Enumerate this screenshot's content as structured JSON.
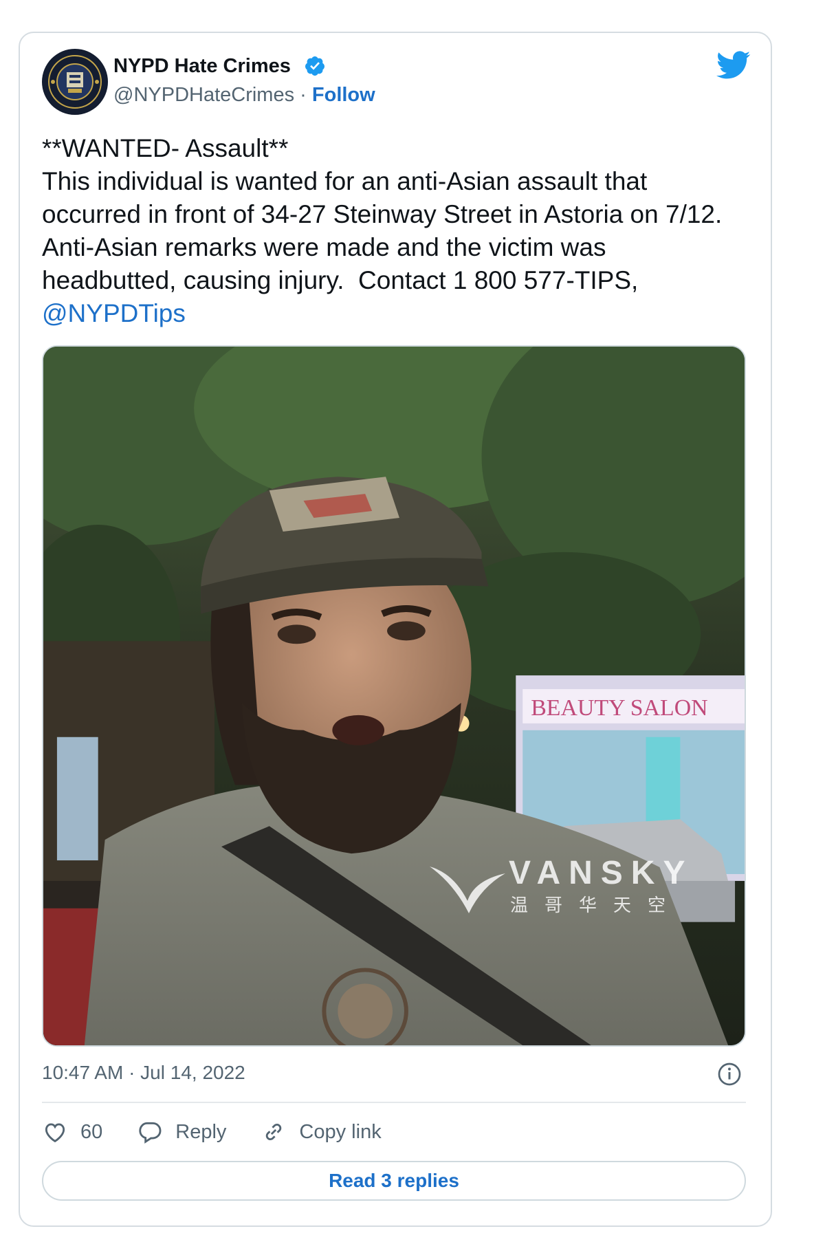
{
  "author": {
    "display_name": "NYPD Hate Crimes",
    "handle": "@NYPDHateCrimes",
    "separator": " · ",
    "follow_label": "Follow",
    "verified_icon": "verified-badge-icon",
    "avatar_icon": "hate-crime-task-force-seal"
  },
  "tweet": {
    "text": "**WANTED- Assault**\nThis individual is wanted for an anti-Asian assault that occurred in front of 34-27 Steinway Street in Astoria on 7/12.  Anti-Asian remarks were made and the victim was headbutted, causing injury.  Contact 1 800 577-TIPS, ",
    "mention": "@NYPDTips"
  },
  "media": {
    "watermark_brand": "VANSKY",
    "watermark_chinese": "温哥华天空",
    "storefront_sign": "BEAUTY SALON"
  },
  "meta": {
    "timestamp": "10:47 AM · Jul 14, 2022"
  },
  "actions": {
    "like_count": "60",
    "reply_label": "Reply",
    "copy_link_label": "Copy link",
    "read_replies_label": "Read 3 replies"
  },
  "colors": {
    "link": "#1d70c9",
    "twitter_blue": "#1d9bf0",
    "secondary_text": "#536471",
    "border": "#cfd9de"
  }
}
